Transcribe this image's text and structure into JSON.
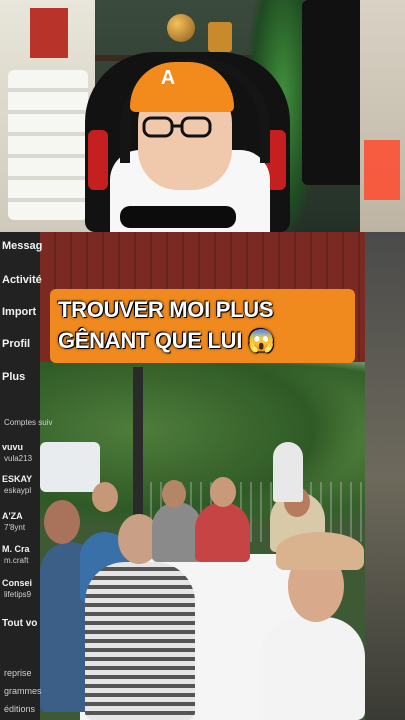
{
  "caption": {
    "line1": "TROUVER MOI PLUS",
    "line2": "GÊNANT QUE LUI 😱"
  },
  "sidebar": {
    "items": [
      {
        "label": "Messag"
      },
      {
        "label": "Activité"
      },
      {
        "label": "Import"
      },
      {
        "label": "Profil"
      },
      {
        "label": "Plus"
      }
    ],
    "section_label": "Comptes suiv",
    "accounts": [
      {
        "name": "vuvu",
        "handle": "vula213"
      },
      {
        "name": "ESKAY",
        "handle": "eskaypl"
      },
      {
        "name": "A'ZA",
        "handle": "7'8ynt"
      },
      {
        "name": "M. Cra",
        "handle": "m.craft"
      },
      {
        "name": "Consei",
        "handle": "lifetips9"
      }
    ],
    "footer": [
      "Tout vo",
      "reprise",
      "grammes",
      "éditions"
    ]
  },
  "cap_logo": "A",
  "colors": {
    "caption_bg": "#f08a1f",
    "cap": "#f28a1c",
    "accent_red": "#c61f1f"
  }
}
